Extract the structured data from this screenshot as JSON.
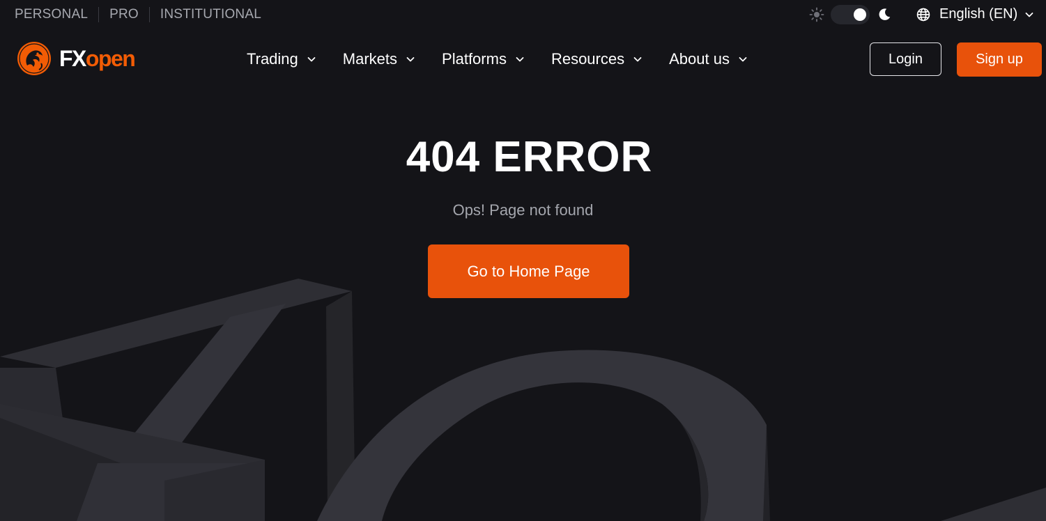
{
  "top_bar": {
    "segments": [
      "PERSONAL",
      "PRO",
      "INSTITUTIONAL"
    ],
    "theme": {
      "light_icon": "sun-icon",
      "dark_icon": "moon-icon",
      "selected": "dark"
    },
    "language": {
      "icon": "globe-icon",
      "label": "English (EN)"
    }
  },
  "header": {
    "logo": {
      "fx": "FX",
      "open": "open"
    },
    "nav": [
      {
        "label": "Trading"
      },
      {
        "label": "Markets"
      },
      {
        "label": "Platforms"
      },
      {
        "label": "Resources"
      },
      {
        "label": "About us"
      }
    ],
    "login_label": "Login",
    "signup_label": "Sign up"
  },
  "main": {
    "title": "404 ERROR",
    "subtitle": "Ops! Page not found",
    "home_button_label": "Go to Home Page"
  },
  "colors": {
    "background": "#141418",
    "accent": "#e8520b",
    "muted_text": "#a4a6ad"
  }
}
